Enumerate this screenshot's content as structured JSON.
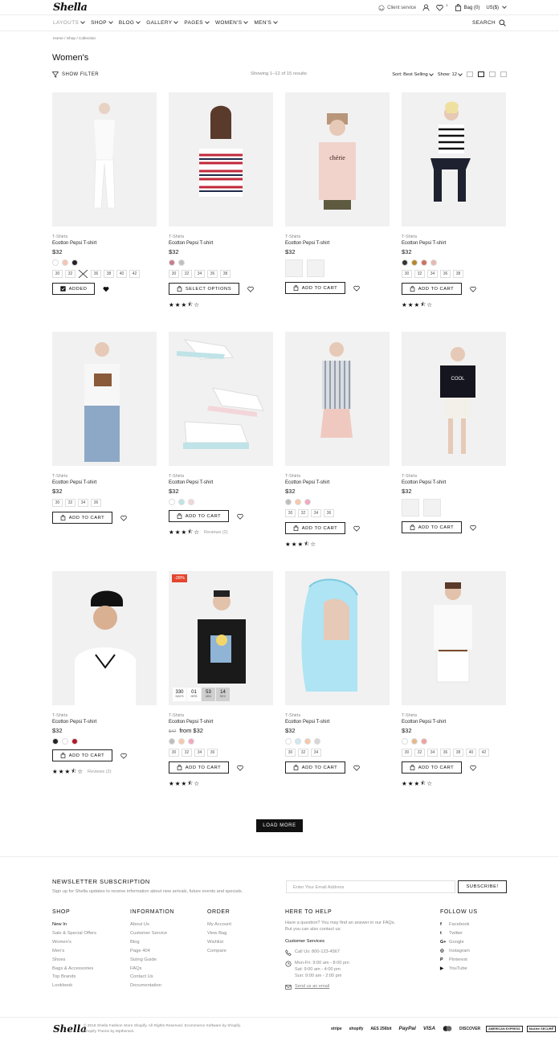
{
  "header": {
    "logo": "Shella",
    "client_service": "Client service",
    "wishlist_count": "1",
    "bag_label": "Bag (0)",
    "currency": "US($)",
    "nav": [
      "LAYOUTS",
      "SHOP",
      "BLOG",
      "GALLERY",
      "PAGES",
      "WOMEN'S",
      "MEN'S"
    ],
    "search_label": "SEARCH"
  },
  "breadcrumb": "Home / Shop / Collection",
  "page_title": "Women's",
  "toolbar": {
    "filter_label": "SHOW FILTER",
    "showing": "Showing 1–12 of 15 results",
    "sort_label": "Sort:",
    "sort_value": "Best Selling",
    "show_label": "Show:",
    "show_value": "12"
  },
  "colors": {
    "accent": "#111111",
    "sale": "#e4452f"
  },
  "products": [
    {
      "category": "T-Shirts",
      "name": "Ecotton Pepsi T-shirt",
      "price": "$32",
      "swatches": [
        "#ffffff",
        "#f4c5b3",
        "#222222"
      ],
      "sizes": [
        "30",
        "32",
        "34",
        "36",
        "38",
        "40",
        "42"
      ],
      "button": "ADDED",
      "rating": null
    },
    {
      "category": "T-Shirts",
      "name": "Ecotton Pepsi T-shirt",
      "price": "$32",
      "swatches": [
        "#c97b8a",
        "#bfbfbf"
      ],
      "sizes": [
        "30",
        "32",
        "34",
        "36",
        "38"
      ],
      "button": "SELECT OPTIONS",
      "rating": 3.5
    },
    {
      "category": "T-Shirts",
      "name": "Ecotton Pepsi T-shirt",
      "price": "$32",
      "thumbs": 2,
      "button": "ADD TO CART",
      "rating": null
    },
    {
      "category": "T-Shirts",
      "name": "Ecotton Pepsi T-shirt",
      "price": "$32",
      "swatches": [
        "#333333",
        "#b8862b",
        "#d07060",
        "#e5b8b0"
      ],
      "sizes": [
        "30",
        "32",
        "34",
        "36",
        "38"
      ],
      "button": "ADD TO CART",
      "rating": 3.5
    },
    {
      "category": "T-Shirts",
      "name": "Ecotton Pepsi T-shirt",
      "price": "$32",
      "sizes": [
        "30",
        "32",
        "34",
        "36"
      ],
      "button": "ADD TO CART",
      "rating": null
    },
    {
      "category": "T-Shirts",
      "name": "Ecotton Pepsi T-shirt",
      "price": "$32",
      "swatches": [
        "#ffffff",
        "#bfe3e6",
        "#f3d6da"
      ],
      "button": "ADD TO CART",
      "rating": 3.5,
      "reviews": "Reviews (2)"
    },
    {
      "category": "T-Shirts",
      "name": "Ecotton Pepsi T-shirt",
      "price": "$32",
      "swatches": [
        "#bdbdbd",
        "#f7c8a8",
        "#f2a8c0"
      ],
      "sizes": [
        "30",
        "32",
        "34",
        "36"
      ],
      "button": "ADD TO CART",
      "rating": 3.5
    },
    {
      "category": "T-Shirts",
      "name": "Ecotton Pepsi T-shirt",
      "price": "$32",
      "thumbs": 2,
      "button": "ADD TO CART",
      "rating": null
    },
    {
      "category": "T-Shirts",
      "name": "Ecotton Pepsi T-shirt",
      "price": "$32",
      "swatches": [
        "#222222",
        "#ffffff",
        "#b0182a"
      ],
      "button": "ADD TO CART",
      "rating": 3.5,
      "reviews": "Reviews (2)"
    },
    {
      "category": "T-Shirts",
      "name": "Ecotton Pepsi T-shirt",
      "price_old": "$47",
      "price": "from $32",
      "sale": "-28%",
      "countdown": [
        {
          "v": "330",
          "l": "DAYS"
        },
        {
          "v": "01",
          "l": "HRS"
        },
        {
          "v": "53",
          "l": "MIN"
        },
        {
          "v": "14",
          "l": "SEC"
        }
      ],
      "swatches": [
        "#bdbdbd",
        "#f7c8a8",
        "#f2a8c0"
      ],
      "sizes": [
        "30",
        "32",
        "34",
        "36"
      ],
      "button": "ADD TO CART",
      "rating": 3.5
    },
    {
      "category": "T-Shirts",
      "name": "Ecotton Pepsi T-shirt",
      "price": "$32",
      "swatches": [
        "#ffffff",
        "#cfe9f2",
        "#f7c8a8",
        "#d6d6d6"
      ],
      "sizes": [
        "30",
        "32",
        "34"
      ],
      "button": "ADD TO CART",
      "rating": null
    },
    {
      "category": "T-Shirts",
      "name": "Ecotton Pepsi T-shirt",
      "price": "$32",
      "swatches": [
        "#ffffff",
        "#e5b88a",
        "#f2a0a0"
      ],
      "sizes": [
        "30",
        "32",
        "34",
        "36",
        "38",
        "40",
        "42"
      ],
      "button": "ADD TO CART",
      "rating": 3.5
    }
  ],
  "load_more": "LOAD MORE",
  "footer": {
    "newsletter_title": "NEWSLETTER SUBSCRIPTION",
    "newsletter_desc": "Sign up for Shella updates to receive information about new arrivals, future events and specials.",
    "email_placeholder": "Enter Your Email Address",
    "subscribe": "SUBSCRIBE!",
    "shop_title": "SHOP",
    "shop_links": [
      "New In",
      "Sale & Special Offers",
      "Women's",
      "Men's",
      "Shoes",
      "Bags & Accessories",
      "Top Brands",
      "Lookbook"
    ],
    "info_title": "INFORMATION",
    "info_links": [
      "About Us",
      "Customer Service",
      "Blog",
      "Page 404",
      "Sizing Guide",
      "FAQs",
      "Contact Us",
      "Documentation"
    ],
    "order_title": "ORDER",
    "order_links": [
      "My Account",
      "View Bag",
      "Wishlist",
      "Compare"
    ],
    "help_title": "HERE TO HELP",
    "help_text_1": "Have a question? You may find an answer in our FAQs.",
    "help_text_2": "But you can also contact us:",
    "customer_services": "Customer Services",
    "call_us": "Call Us: 800-123-4567",
    "hours_1": "Mon-Fri: 9:00 am - 8:00 pm",
    "hours_2": "Sat: 9:00 am - 4:00 pm",
    "hours_3": "Sun: 9:00 am - 2:00 pm",
    "email_link": "Send us an email",
    "follow_title": "FOLLOW US",
    "social": [
      "Facebook",
      "Twitter",
      "Google",
      "Instagram",
      "Pinterest",
      "YouTube"
    ],
    "logo": "Shella",
    "copyright_1": "© 2018 Shella Fashion Store Shopify. All Rights Reserved. Ecommerce Software by Shopify.",
    "copyright_2": "Shopify Theme by Mpthemes.",
    "payments": [
      "stripe",
      "shopify",
      "AES 256bit",
      "PayPal",
      "VISA",
      "mastercard",
      "DISCOVER",
      "AMERICAN EXPRESS",
      "McAfee SECURE"
    ]
  }
}
